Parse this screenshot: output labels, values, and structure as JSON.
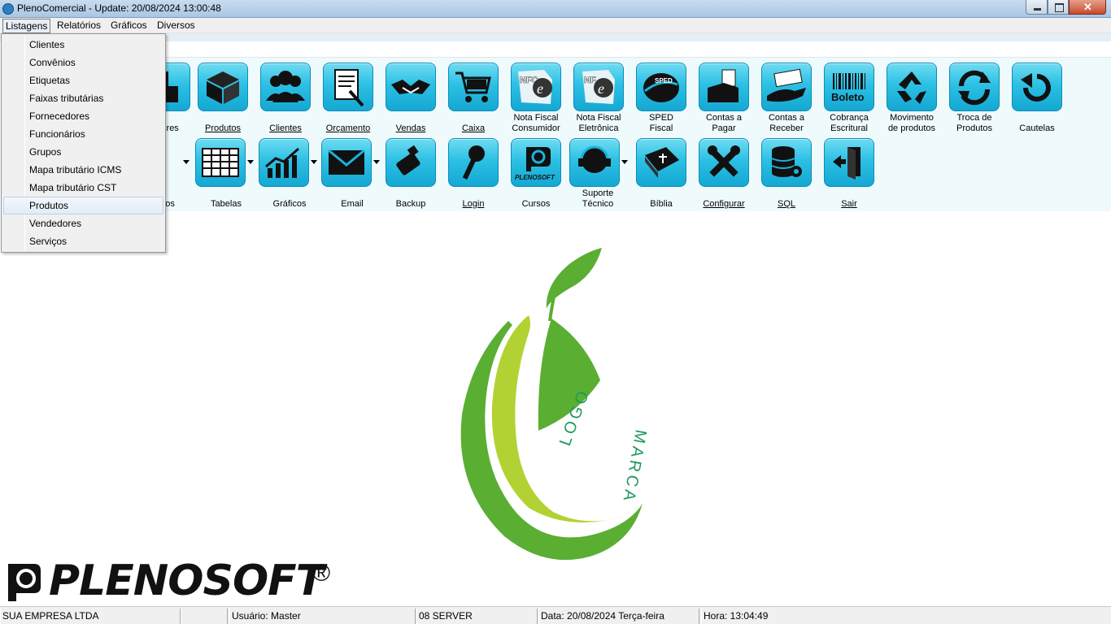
{
  "window": {
    "title": "PlenoComercial - Update: 20/08/2024 13:00:48"
  },
  "menubar": [
    "Listagens",
    "Relatórios",
    "Gráficos",
    "Diversos"
  ],
  "dropdown": {
    "items": [
      "Clientes",
      "Convênios",
      "Etiquetas",
      "Faixas tributárias",
      "Fornecedores",
      "Funcionários",
      "Grupos",
      "Mapa tributário ICMS",
      "Mapa tributário CST",
      "Produtos",
      "Vendedores",
      "Serviços"
    ],
    "selected": "Produtos"
  },
  "toolbar_row1": [
    {
      "label": "edores",
      "icon": "seller-icon"
    },
    {
      "label": "Produtos",
      "icon": "box-icon"
    },
    {
      "label": "Clientes",
      "icon": "people-icon"
    },
    {
      "label": "Orçamento",
      "icon": "quote-icon"
    },
    {
      "label": "Vendas",
      "icon": "handshake-icon"
    },
    {
      "label": "Caixa",
      "icon": "cart-icon"
    },
    {
      "label": "Nota Fiscal\nConsumidor",
      "icon": "nfce-icon"
    },
    {
      "label": "Nota Fiscal\nEletrônica",
      "icon": "nfe-icon"
    },
    {
      "label": "SPED\nFiscal",
      "icon": "sped-icon"
    },
    {
      "label": "Contas a\nPagar",
      "icon": "pay-icon"
    },
    {
      "label": "Contas a\nReceber",
      "icon": "receive-icon"
    },
    {
      "label": "Cobrança\nEscritural",
      "icon": "barcode-icon"
    },
    {
      "label": "Movimento\nde produtos",
      "icon": "recycle-icon"
    },
    {
      "label": "Troca de\nProdutos",
      "icon": "swap-icon"
    },
    {
      "label": "Cautelas",
      "icon": "undo-icon"
    }
  ],
  "toolbar_row2": [
    {
      "label": "stros",
      "icon": "register-icon"
    },
    {
      "label": "Tabelas",
      "icon": "table-icon"
    },
    {
      "label": "Gráficos",
      "icon": "chart-icon"
    },
    {
      "label": "Email",
      "icon": "mail-icon"
    },
    {
      "label": "Backup",
      "icon": "usb-icon"
    },
    {
      "label": "Login",
      "icon": "key-icon"
    },
    {
      "label": "Cursos",
      "icon": "plenosoft-icon"
    },
    {
      "label": "Suporte\nTécnico",
      "icon": "support-icon"
    },
    {
      "label": "Bíblia",
      "icon": "bible-icon"
    },
    {
      "label": "Configurar",
      "icon": "tools-icon"
    },
    {
      "label": "SQL",
      "icon": "database-icon"
    },
    {
      "label": "Sair",
      "icon": "exit-icon"
    }
  ],
  "logo": {
    "word1": "LOGO",
    "word2": "MARCA"
  },
  "brand": {
    "name": "PLENOSOFT",
    "reg": "®",
    "icon_label": "PLENOSOFT"
  },
  "statusbar": {
    "company": "SUA EMPRESA LTDA",
    "user": "Usuário: Master",
    "server": "08 SERVER",
    "date": "Data: 20/08/2024 Terça-feira",
    "time": "Hora: 13:04:49"
  },
  "colors": {
    "accent": "#2cc0e4",
    "logo_dark_green": "#5aae32",
    "logo_light_green": "#b2d234",
    "logo_text": "#1e9a5b"
  }
}
